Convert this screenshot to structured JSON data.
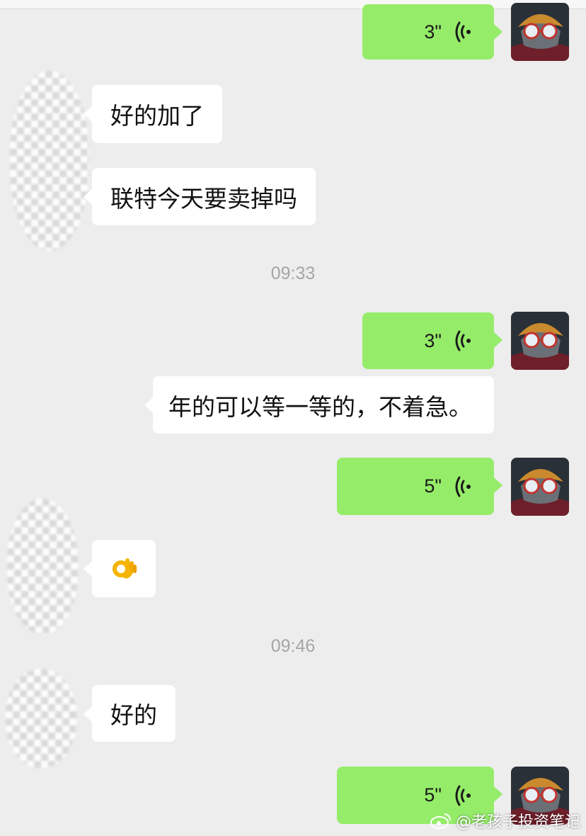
{
  "chat": {
    "msg_voice_1": {
      "duration": "3\""
    },
    "msg_text_1": "好的加了",
    "msg_text_2": "联特今天要卖掉吗",
    "time_1": "09:33",
    "msg_voice_2": {
      "duration": "3\""
    },
    "msg_text_3": "年的可以等一等的，不着急。",
    "msg_voice_3": {
      "duration": "5\""
    },
    "msg_emoji_1": {
      "icon": "ok-hand-icon"
    },
    "time_2": "09:46",
    "msg_text_4": "好的",
    "msg_voice_4": {
      "duration": "5\""
    }
  },
  "watermark": {
    "text": "@老孩子投资笔记",
    "icon": "weibo-icon"
  },
  "colors": {
    "background": "#ededed",
    "outgoing_bubble": "#95ec69",
    "incoming_bubble": "#ffffff",
    "timestamp": "#a6a6a6"
  }
}
